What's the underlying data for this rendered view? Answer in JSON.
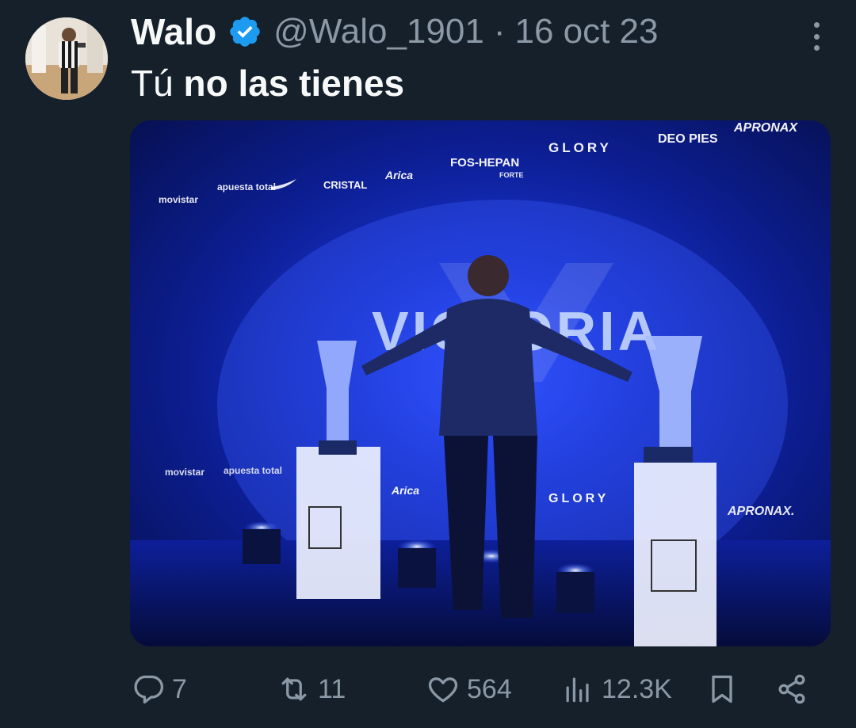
{
  "tweet": {
    "author_name": "Walo",
    "handle": "@Walo_1901",
    "separator": "·",
    "date": "16 oct 23",
    "text_plain": "Tú ",
    "text_bold": "no las tienes"
  },
  "media": {
    "sponsors_top": [
      "movistar",
      "apuesta total",
      "CRISTAL",
      "Arica",
      "FOS-HEPAN",
      "FORTE",
      "GLORY",
      "DEO PIES",
      "APRONAX"
    ],
    "sponsors_bottom": [
      "movistar",
      "apuesta total",
      "Arica",
      "GLORY",
      "APRONAX."
    ],
    "banner_text": "VICTORIA"
  },
  "actions": {
    "replies": "7",
    "reposts": "11",
    "likes": "564",
    "views": "12.3K"
  },
  "colors": {
    "background": "#15202b",
    "text_primary": "#f7f9f9",
    "text_secondary": "#8b98a5",
    "verified": "#1d9bf0"
  },
  "icons": [
    "verified-badge-icon",
    "more-options-icon",
    "reply-icon",
    "repost-icon",
    "like-icon",
    "views-icon",
    "bookmark-icon",
    "share-icon"
  ]
}
